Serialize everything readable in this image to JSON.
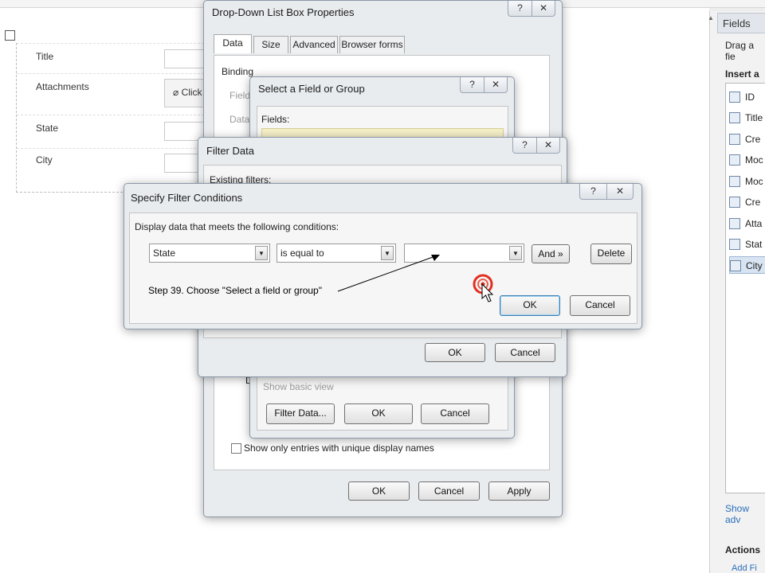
{
  "form": {
    "fields": [
      {
        "label": "Title"
      },
      {
        "label": "Attachments",
        "button": "Click"
      },
      {
        "label": "State"
      },
      {
        "label": "City"
      }
    ]
  },
  "right_pane": {
    "header": "Fields",
    "hint": "Drag a fie",
    "insert_label": "Insert a",
    "items": [
      "ID",
      "Title",
      "Cre",
      "Moc",
      "Moc",
      "Cre",
      "Atta",
      "Stat",
      "City"
    ],
    "show_advanced": "Show adv",
    "actions": "Actions",
    "add_field": "Add Fi"
  },
  "dropdown_props": {
    "title": "Drop-Down List Box Properties",
    "tabs": [
      "Data",
      "Size",
      "Advanced",
      "Browser forms"
    ],
    "binding_label": "Binding",
    "field_partial": "Field",
    "data_partial": "Data",
    "d_partial": "D",
    "show_unique": "Show only entries with unique display names",
    "ok": "OK",
    "cancel": "Cancel",
    "apply": "Apply"
  },
  "select_field": {
    "title": "Select a Field or Group",
    "fields_label": "Fields:",
    "show_basic": "Show basic view",
    "filter_data": "Filter Data...",
    "ok": "OK",
    "cancel": "Cancel"
  },
  "filter_data": {
    "title": "Filter Data",
    "existing": "Existing filters:",
    "ok": "OK",
    "cancel": "Cancel"
  },
  "filter_conditions": {
    "title": "Specify Filter Conditions",
    "instruction": "Display data that meets the following conditions:",
    "field": "State",
    "operator": "is equal to",
    "value": "",
    "and_btn": "And »",
    "delete_btn": "Delete",
    "ok": "OK",
    "cancel": "Cancel"
  },
  "caption": "Step 39. Choose \"Select a field or group\"",
  "icons": {
    "help": "?",
    "close": "✕",
    "dropdown": "▼"
  }
}
